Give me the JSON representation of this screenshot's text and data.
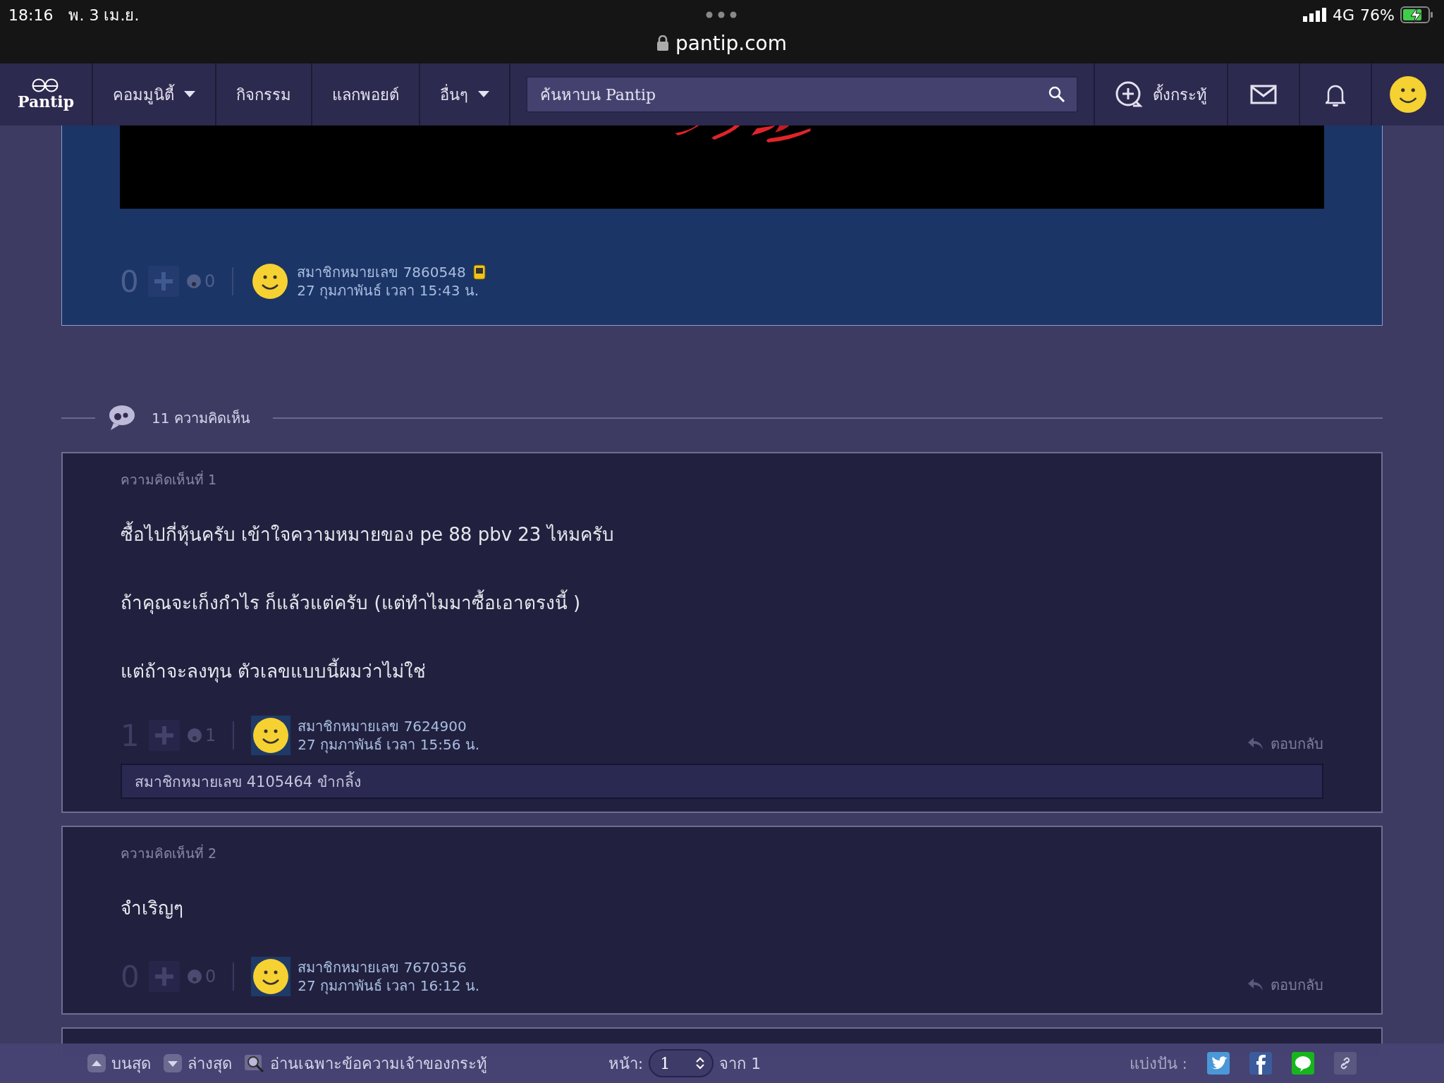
{
  "status_bar": {
    "time": "18:16",
    "date": "พ. 3 เม.ย.",
    "network": "4G",
    "battery": "76%",
    "charging": true
  },
  "browser": {
    "url": "pantip.com"
  },
  "nav": {
    "logo": "Pantip",
    "items": [
      {
        "label": "คอมมูนิตี้",
        "dropdown": true
      },
      {
        "label": "กิจกรรม",
        "dropdown": false
      },
      {
        "label": "แลกพอยต์",
        "dropdown": false
      },
      {
        "label": "อื่นๆ",
        "dropdown": true
      }
    ],
    "search": {
      "placeholder": "ค้นหาบน Pantip"
    },
    "create_topic": "ตั้งกระทู้"
  },
  "post_footer": {
    "score": "0",
    "emotion_count": "0",
    "author": "สมาชิกหมายเลข 7860548",
    "time": "27 กุมภาพันธ์ เวลา 15:43 น."
  },
  "comments_header": {
    "count": "11 ความคิดเห็น"
  },
  "comments": [
    {
      "number_label": "ความคิดเห็นที่ 1",
      "paragraphs": [
        "ซื้อไปกี่หุ้นครับ  เข้าใจความหมายของ pe 88  pbv 23 ไหมครับ",
        "ถ้าคุณจะเก็งกำไร ก็แล้วแต่ครับ  (แต่ทำไมมาซื้อเอาตรงนี้ )",
        "แต่ถ้าจะลงทุน ตัวเลขแบบนี้ผมว่าไม่ใช่"
      ],
      "score": "1",
      "emotion_count": "1",
      "author": "สมาชิกหมายเลข 7624900",
      "time": "27 กุมภาพันธ์ เวลา 15:56 น.",
      "reply": "ตอบกลับ",
      "liked_by": "สมาชิกหมายเลข 4105464 ขำกลิ้ง"
    },
    {
      "number_label": "ความคิดเห็นที่ 2",
      "paragraphs": [
        "จำเริญๆ"
      ],
      "score": "0",
      "emotion_count": "0",
      "author": "สมาชิกหมายเลข 7670356",
      "time": "27 กุมภาพันธ์ เวลา 16:12 น.",
      "reply": "ตอบกลับ"
    }
  ],
  "bottom_bar": {
    "top": "บนสุด",
    "bottom": "ล่างสุด",
    "owner_only": "อ่านเฉพาะข้อความเจ้าของกระทู้",
    "page_label": "หน้า:",
    "page": "1",
    "page_total": "จาก 1",
    "share": "แบ่งปัน :"
  }
}
